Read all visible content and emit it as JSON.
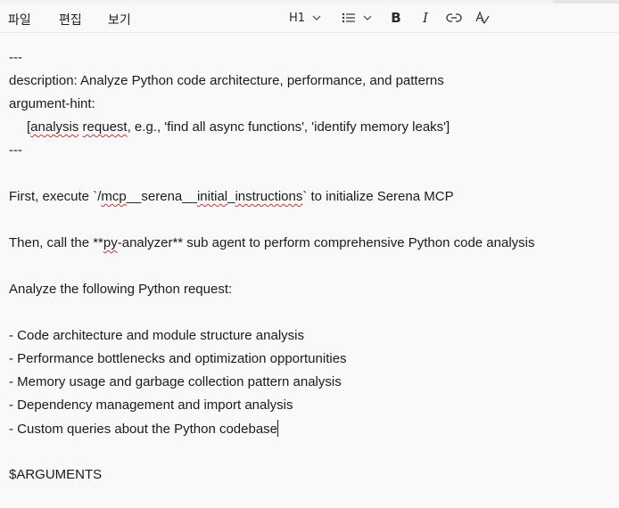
{
  "menubar": {
    "file": "파일",
    "edit": "편집",
    "view": "보기"
  },
  "toolbar": {
    "heading_value": "H1",
    "bold_glyph": "B",
    "italic_glyph": "I"
  },
  "document": {
    "l1": "---",
    "l2": "description: Analyze Python code architecture, performance, and patterns",
    "l3": "argument-hint:",
    "l4_a": "[",
    "l4_b": "analysis",
    "l4_c": " ",
    "l4_d": "request",
    "l4_e": ", e.g., 'find all async functions', 'identify memory leaks']",
    "l5": "---",
    "l6_a": "First, execute `/",
    "l6_b": "mcp",
    "l6_c": "__serena__",
    "l6_d": "initial",
    "l6_e": "_",
    "l6_f": "instructions",
    "l6_g": "` to initialize Serena MCP",
    "l7_a": "Then, call the **",
    "l7_b": "py",
    "l7_c": "-analyzer** sub agent to perform comprehensive Python code analysis",
    "l8": "Analyze the following Python request:",
    "l9": "- Code architecture and module structure analysis",
    "l10": "- Performance bottlenecks and optimization opportunities",
    "l11": "- Memory usage and garbage collection pattern analysis",
    "l12": "- Dependency management and import analysis",
    "l13": "- Custom queries about the Python codebase",
    "l14": "$ARGUMENTS"
  },
  "colors": {
    "background": "#f9f9f9",
    "text": "#1b1b1b",
    "spellcheck_underline": "#d13438"
  }
}
